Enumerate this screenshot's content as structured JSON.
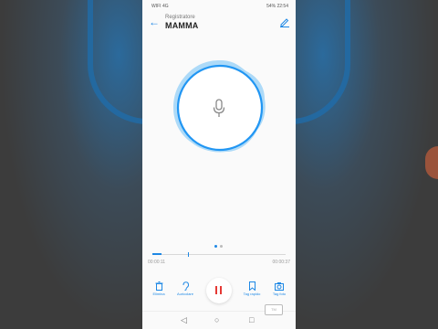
{
  "status_bar": {
    "left_text": "WIFI 4G",
    "right_text": "54% 22:54"
  },
  "header": {
    "subtitle": "Registratore",
    "title": "MAMMA"
  },
  "timeline": {
    "elapsed": "00:00:11",
    "total": "00:00:37"
  },
  "actions": [
    {
      "label": "Elimina",
      "icon": "trash-icon"
    },
    {
      "label": "Auricolare",
      "icon": "ear-icon"
    },
    {
      "label": "Tag rapido",
      "icon": "bookmark-icon"
    },
    {
      "label": "Tag foto",
      "icon": "camera-icon"
    }
  ],
  "colors": {
    "accent": "#1e88e5",
    "pause": "#e53935",
    "glow": "#8ecbf5"
  },
  "watermark": "TM"
}
